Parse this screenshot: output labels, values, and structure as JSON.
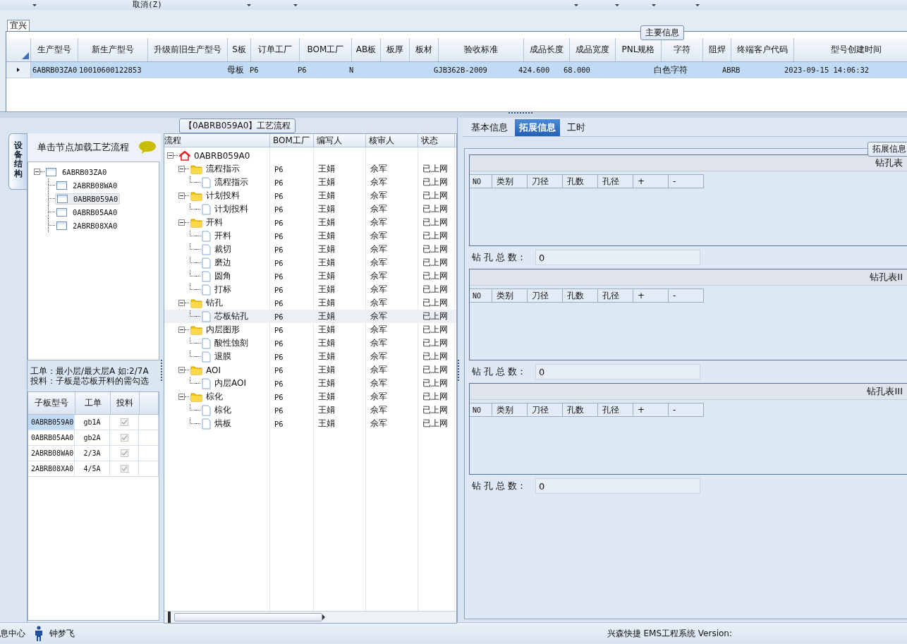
{
  "toolbar": {
    "items": [
      "取消(Z)"
    ]
  },
  "group_tab": "宜兴",
  "main_info": {
    "legend": "主要信息",
    "columns": [
      "生产型号",
      "新生产型号",
      "升级前旧生产型号",
      "S板",
      "订单工厂",
      "BOM工厂",
      "AB板",
      "板厚",
      "板材",
      "验收标准",
      "成品长度",
      "成品宽度",
      "PNL规格",
      "字符",
      "阻焊",
      "终端客户代码",
      "型号创建时间"
    ],
    "rows": [
      {
        "selected": true,
        "cells": [
          "6ABRB03ZA0",
          "10010600122853",
          "",
          "母板",
          "P6",
          "P6",
          "N",
          "",
          "",
          "GJB362B-2009",
          "424.600",
          "68.000",
          "",
          "白色字符",
          "",
          "ABRB",
          "2023-09-15 14:06:32"
        ]
      }
    ]
  },
  "left_panel": {
    "side_tab": "设备结构",
    "header": "单击节点加载工艺流程",
    "tree": {
      "label": "6ABRB03ZA0",
      "expanded": true,
      "selected": false,
      "children": [
        {
          "label": "2ABRB08WA0",
          "selected": false
        },
        {
          "label": "0ABRB059A0",
          "selected": true
        },
        {
          "label": "0ABRB05AA0",
          "selected": false
        },
        {
          "label": "2ABRB08XA0",
          "selected": false
        }
      ]
    },
    "notes": [
      "工单：最小层/最大层A 如:2/7A",
      "投料：子板是芯板开料的需勾选"
    ],
    "sub_table": {
      "columns": [
        "子板型号",
        "工单",
        "投料"
      ],
      "rows": [
        {
          "cells": [
            "0ABRB059A0",
            "gb1A"
          ],
          "checked": true,
          "selected": true
        },
        {
          "cells": [
            "0ABRB05AA0",
            "gb2A"
          ],
          "checked": true,
          "selected": false
        },
        {
          "cells": [
            "2ABRB08WA0",
            "2/3A"
          ],
          "checked": true,
          "selected": false
        },
        {
          "cells": [
            "2ABRB08XA0",
            "4/5A"
          ],
          "checked": true,
          "selected": false
        }
      ]
    }
  },
  "process_panel": {
    "title": "【0ABRB059A0】工艺流程",
    "columns": [
      "流程",
      "BOM工厂",
      "编写人",
      "核审人",
      "状态"
    ],
    "tree": {
      "kind": "root",
      "label": "0ABRB059A0",
      "expanded": true,
      "children": [
        {
          "kind": "folder",
          "label": "流程指示",
          "cells": [
            "P6",
            "王娟",
            "佘军",
            "已上网"
          ],
          "expanded": true,
          "children": [
            {
              "kind": "file",
              "label": "流程指示",
              "cells": [
                "P6",
                "王娟",
                "佘军",
                "已上网"
              ],
              "selected": false
            }
          ]
        },
        {
          "kind": "folder",
          "label": "计划投料",
          "cells": [
            "P6",
            "王娟",
            "佘军",
            "已上网"
          ],
          "expanded": true,
          "children": [
            {
              "kind": "file",
              "label": "计划投料",
              "cells": [
                "P6",
                "王娟",
                "佘军",
                "已上网"
              ],
              "selected": false
            }
          ]
        },
        {
          "kind": "folder",
          "label": "开料",
          "cells": [
            "P6",
            "王娟",
            "佘军",
            "已上网"
          ],
          "expanded": true,
          "children": [
            {
              "kind": "file",
              "label": "开料",
              "cells": [
                "P6",
                "王娟",
                "佘军",
                "已上网"
              ],
              "selected": false
            },
            {
              "kind": "file",
              "label": "裁切",
              "cells": [
                "P6",
                "王娟",
                "佘军",
                "已上网"
              ],
              "selected": false
            },
            {
              "kind": "file",
              "label": "磨边",
              "cells": [
                "P6",
                "王娟",
                "佘军",
                "已上网"
              ],
              "selected": false
            },
            {
              "kind": "file",
              "label": "圆角",
              "cells": [
                "P6",
                "王娟",
                "佘军",
                "已上网"
              ],
              "selected": false
            },
            {
              "kind": "file",
              "label": "打标",
              "cells": [
                "P6",
                "王娟",
                "佘军",
                "已上网"
              ],
              "selected": false
            }
          ]
        },
        {
          "kind": "folder",
          "label": "钻孔",
          "cells": [
            "P6",
            "王娟",
            "佘军",
            "已上网"
          ],
          "expanded": true,
          "children": [
            {
              "kind": "file",
              "label": "芯板钻孔",
              "cells": [
                "P6",
                "王娟",
                "佘军",
                "已上网"
              ],
              "selected": true
            }
          ]
        },
        {
          "kind": "folder",
          "label": "内层图形",
          "cells": [
            "P6",
            "王娟",
            "佘军",
            "已上网"
          ],
          "expanded": true,
          "children": [
            {
              "kind": "file",
              "label": "酸性蚀刻",
              "cells": [
                "P6",
                "王娟",
                "佘军",
                "已上网"
              ],
              "selected": false
            },
            {
              "kind": "file",
              "label": "退膜",
              "cells": [
                "P6",
                "王娟",
                "佘军",
                "已上网"
              ],
              "selected": false
            }
          ]
        },
        {
          "kind": "folder",
          "label": "AOI",
          "cells": [
            "P6",
            "王娟",
            "佘军",
            "已上网"
          ],
          "expanded": true,
          "children": [
            {
              "kind": "file",
              "label": "内层AOI",
              "cells": [
                "P6",
                "王娟",
                "佘军",
                "已上网"
              ],
              "selected": false
            }
          ]
        },
        {
          "kind": "folder",
          "label": "棕化",
          "cells": [
            "P6",
            "王娟",
            "佘军",
            "已上网"
          ],
          "expanded": true,
          "children": [
            {
              "kind": "file",
              "label": "棕化",
              "cells": [
                "P6",
                "王娟",
                "佘军",
                "已上网"
              ],
              "selected": false
            },
            {
              "kind": "file",
              "label": "烘板",
              "cells": [
                "P6",
                "王娟",
                "佘军",
                "已上网"
              ],
              "selected": false
            }
          ]
        }
      ]
    }
  },
  "right_panel": {
    "tabs": [
      {
        "label": "基本信息",
        "selected": false
      },
      {
        "label": "拓展信息",
        "selected": true
      },
      {
        "label": "工时",
        "selected": false
      }
    ],
    "legend": "拓展信息",
    "drill_tables": [
      {
        "title": "钻孔表",
        "columns": [
          "NO",
          "类别",
          "刀径",
          "孔数",
          "孔径",
          "+",
          "-"
        ],
        "total_label": "钻 孔 总 数：",
        "total_value": "0"
      },
      {
        "title": "钻孔表II",
        "columns": [
          "NO",
          "类别",
          "刀径",
          "孔数",
          "孔径",
          "+",
          "-"
        ],
        "total_label": "钻 孔 总 数：",
        "total_value": "0"
      },
      {
        "title": "钻孔表III",
        "columns": [
          "NO",
          "类别",
          "刀径",
          "孔数",
          "孔径",
          "+",
          "-"
        ],
        "total_label": "钻 孔 总 数：",
        "total_value": "0"
      }
    ]
  },
  "status_bar": {
    "left": "息中心",
    "user": "钟梦飞",
    "right": "兴森快捷 EMS工程系统 Version:"
  }
}
